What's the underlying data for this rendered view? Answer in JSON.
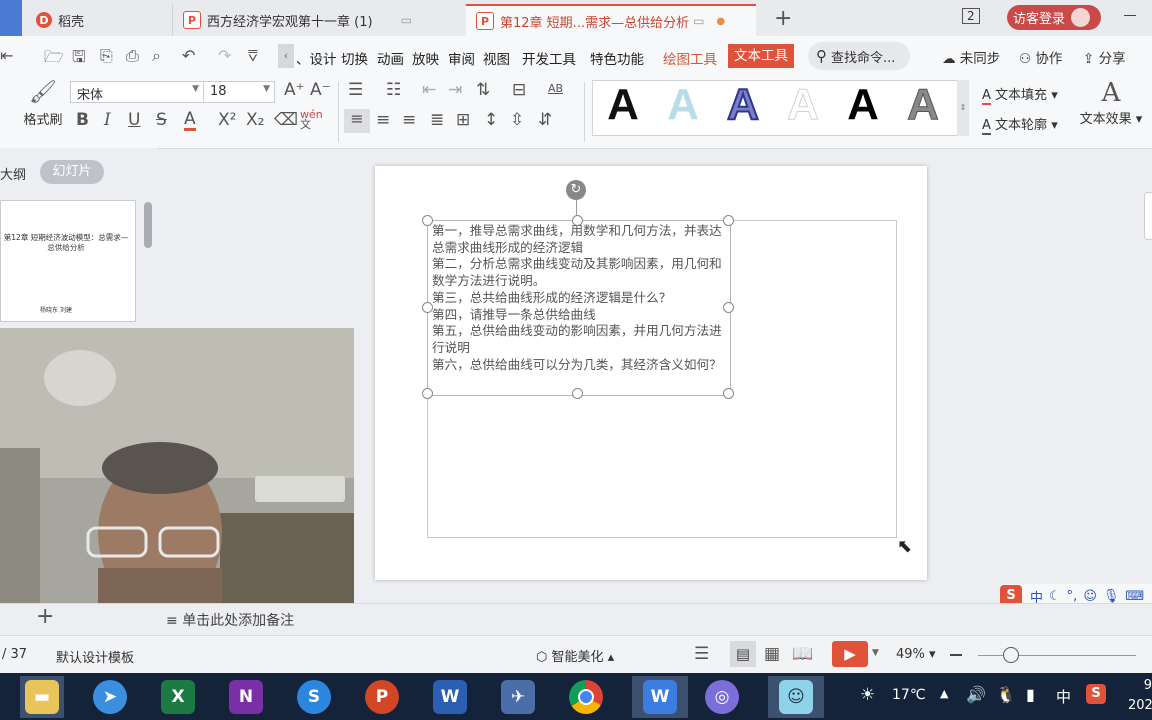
{
  "tabs": [
    {
      "icon_text": "D",
      "label": "稻壳",
      "color": "#e0533b"
    },
    {
      "icon_text": "P",
      "label": "西方经济学宏观第十一章 (1)",
      "color": "#e0533b"
    },
    {
      "icon_text": "P",
      "label": "第12章  短期...需求—总供给分析",
      "color": "#e0533b"
    }
  ],
  "header_right": {
    "window_count": "2",
    "login_label": "访客登录"
  },
  "menu": {
    "items": [
      "设计",
      "切换",
      "动画",
      "放映",
      "审阅",
      "视图",
      "开发工具",
      "特色功能",
      "绘图工具",
      "文本工具"
    ],
    "search_label": "查找命令...",
    "sync_label": "未同步",
    "collab_label": "协作",
    "share_label": "分享"
  },
  "ribbon": {
    "format_painter_label": "格式刷",
    "font_name": "宋体",
    "font_size": "18",
    "fill_label": "文本填充",
    "outline_label": "文本轮廓",
    "effect_label": "文本效果",
    "ab_label": "AB",
    "wen_label": "wén",
    "style_glyph": "A"
  },
  "left_panel": {
    "outline_label": "大纲",
    "slides_label": "幻灯片",
    "thumb_title": "第12章  短期经济波动模型：总需求—总供给分析",
    "thumb_author": "杨晓东  刘建"
  },
  "slide": {
    "lines": [
      "第一，推导总需求曲线，用数学和几何方法，并表达总需求曲线形成的经济逻辑",
      "第二，分析总需求曲线变动及其影响因素，用几何和数学方法进行说明。",
      "第三，总共给曲线形成的经济逻辑是什么？",
      "第四，请推导一条总供给曲线",
      "第五，总供给曲线变动的影响因素，并用几何方法进行说明",
      "第六，总供给曲线可以分为几类，其经济含义如何？"
    ]
  },
  "notes": {
    "placeholder": "单击此处添加备注"
  },
  "status": {
    "page_indicator": "/ 37",
    "template_label": "默认设计模板",
    "beautify_label": "智能美化",
    "zoom": "49%",
    "zoom_level": 0.49
  },
  "ime": {
    "lang": "中"
  },
  "taskbar": {
    "apps": [
      "file-explorer",
      "browser-blue",
      "excel",
      "onenote",
      "sogou",
      "powerpoint",
      "word",
      "swift",
      "chrome",
      "wps",
      "planet",
      "live"
    ],
    "temperature": "17℃",
    "ime_lang": "中",
    "clock_partial": "9",
    "year_partial": "202"
  },
  "colors": {
    "accent": "#e0533b",
    "active_tool": "#e0533b"
  }
}
